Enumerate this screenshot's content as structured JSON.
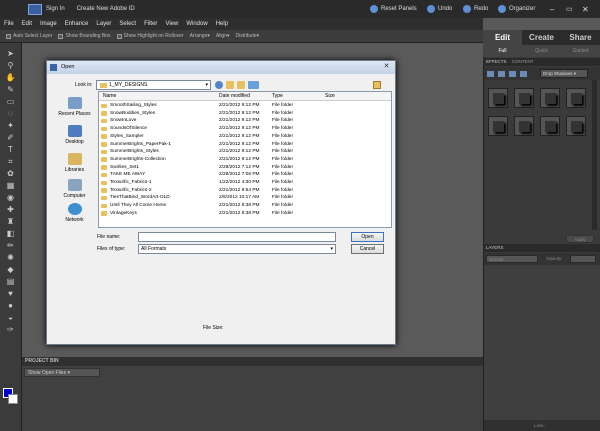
{
  "titlebar": {
    "sign_in": "Sign In",
    "create_id": "Create New Adobe ID",
    "reset_panels": "Reset Panels",
    "undo": "Undo",
    "redo": "Redo",
    "organizer": "Organizer"
  },
  "menubar": {
    "items": [
      "File",
      "Edit",
      "Image",
      "Enhance",
      "Layer",
      "Select",
      "Filter",
      "View",
      "Window",
      "Help"
    ]
  },
  "options": {
    "auto_select": "Auto Select Layer",
    "show_bbox": "Show Bounding Box",
    "show_highlight": "Show Highlight on Rollover",
    "arrange": "Arrange",
    "align": "Align",
    "distribute": "Distribute"
  },
  "colors": {
    "foreground": "#0000cc",
    "background": "#ffffff"
  },
  "modes": {
    "edit": "Edit",
    "create": "Create",
    "share": "Share",
    "full": "Full",
    "quick": "Quick",
    "guided": "Guided"
  },
  "effects": {
    "tab1": "EFFECTS",
    "tab2": "CONTENT",
    "filter": "Drop Shadows",
    "apply": "Apply"
  },
  "layers": {
    "title": "LAYERS",
    "blend": "Normal",
    "opacity_label": "Opacity:",
    "lock_label": "Lock:"
  },
  "project_bin": {
    "title": "PROJECT BIN",
    "show": "Show Open Files"
  },
  "dialog": {
    "title": "Open",
    "look_in_label": "Look in:",
    "look_in_value": "1_MY_DESIGNS",
    "places": [
      "Recent Places",
      "Desktop",
      "Libraries",
      "Computer",
      "Network"
    ],
    "columns": {
      "name": "Name",
      "date": "Date modified",
      "type": "Type",
      "size": "Size"
    },
    "files": [
      {
        "name": "SmoothSailing_Styles",
        "date": "2/21/2012 9:12 PM",
        "type": "File folder"
      },
      {
        "name": "SnowBuddies_Styles",
        "date": "2/21/2012 9:12 PM",
        "type": "File folder"
      },
      {
        "name": "SnowInLove",
        "date": "2/21/2012 9:12 PM",
        "type": "File folder"
      },
      {
        "name": "SoundsOfSilence",
        "date": "2/21/2012 9:12 PM",
        "type": "File folder"
      },
      {
        "name": "Styles_Sampler",
        "date": "2/21/2012 9:12 PM",
        "type": "File folder"
      },
      {
        "name": "SummerBrights_PaperPak-1",
        "date": "2/21/2012 9:12 PM",
        "type": "File folder"
      },
      {
        "name": "SummerBrights_Styles",
        "date": "2/21/2012 9:12 PM",
        "type": "File folder"
      },
      {
        "name": "SummerBrights-Collection",
        "date": "2/21/2012 9:12 PM",
        "type": "File folder"
      },
      {
        "name": "Swirlies_Set1",
        "date": "2/29/2012 7:12 PM",
        "type": "File folder"
      },
      {
        "name": "TAKE ME AWAY",
        "date": "2/28/2012 7:06 PM",
        "type": "File folder"
      },
      {
        "name": "Texturific_Fabrics-1",
        "date": "1/22/2012 4:30 PM",
        "type": "File folder"
      },
      {
        "name": "Texturific_Fabrics-2",
        "date": "2/21/2012 9:54 PM",
        "type": "File folder"
      },
      {
        "name": "TiesThatBind_WordArt-OLD",
        "date": "2/6/2012 10:17 AM",
        "type": "File folder"
      },
      {
        "name": "Until They All Come Home",
        "date": "2/21/2012 8:38 PM",
        "type": "File folder"
      },
      {
        "name": "VintageKeys",
        "date": "2/21/2012 8:38 PM",
        "type": "File folder"
      }
    ],
    "file_name_label": "File name:",
    "file_name_value": "",
    "file_type_label": "Files of type:",
    "file_type_value": "All Formats",
    "open": "Open",
    "cancel": "Cancel",
    "file_size_label": "File Size:"
  }
}
